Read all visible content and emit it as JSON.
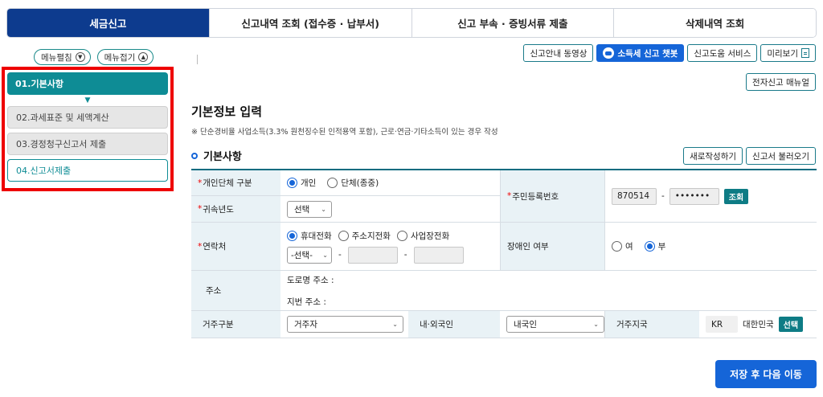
{
  "tabs": [
    {
      "label": "세금신고",
      "active": true
    },
    {
      "label": "신고내역 조회 (접수증 · 납부서)",
      "active": false
    },
    {
      "label": "신고 부속 · 증빙서류 제출",
      "active": false
    },
    {
      "label": "삭제내역 조회",
      "active": false
    }
  ],
  "menu": {
    "expand_label": "메뉴펼침",
    "collapse_label": "메뉴접기",
    "steps": [
      {
        "label": "01.기본사항",
        "state": "active"
      },
      {
        "label": "02.과세표준 및 세액계산",
        "state": "done"
      },
      {
        "label": "03.경정청구신고서 제출",
        "state": "done"
      },
      {
        "label": "04.신고서제출",
        "state": "todo"
      }
    ]
  },
  "top_buttons": {
    "video": "신고안내 동영상",
    "chatbot": "소득세 신고 챗봇",
    "help": "신고도움 서비스",
    "preview": "미리보기"
  },
  "manual_button": "전자신고 매뉴얼",
  "page_title": "기본정보 입력",
  "note": "※ 단순경비율 사업소득(3.3% 원천징수된 인적용역 포함), 근로·연금·기타소득이 있는 경우 작성",
  "section": {
    "title": "기본사항",
    "new_button": "새로작성하기",
    "load_button": "신고서 불러오기"
  },
  "form": {
    "type_label": "개인단체 구분",
    "type_options": [
      "개인",
      "단체(종중)"
    ],
    "type_selected": 0,
    "year_label": "귀속년도",
    "year_value": "선택",
    "rrn_label": "주민등록번호",
    "rrn_front": "870514",
    "rrn_dash": "-",
    "rrn_back": "•••••••",
    "rrn_button": "조회",
    "contact_label": "연락처",
    "contact_options": [
      "휴대전화",
      "주소지전화",
      "사업장전화"
    ],
    "contact_selected": 0,
    "contact_select": "-선택-",
    "contact_dash": "-",
    "disabled_label": "장애인 여부",
    "disabled_options": [
      "여",
      "부"
    ],
    "disabled_selected": 1,
    "address_label": "주소",
    "road_address": "도로명 주소 :",
    "lot_address": "지번 주소 :",
    "residence_label": "거주구분",
    "residence_value": "거주자",
    "nationality_label": "내·외국인",
    "nationality_value": "내국인",
    "country_label": "거주지국",
    "country_code": "KR",
    "country_name": "대한민국",
    "country_button": "선택"
  },
  "next_button": "저장 후 다음 이동",
  "colors": {
    "primary": "#1565d8",
    "navy": "#0d3b8e",
    "teal": "#0e8c95",
    "highlight": "#ee0000"
  }
}
